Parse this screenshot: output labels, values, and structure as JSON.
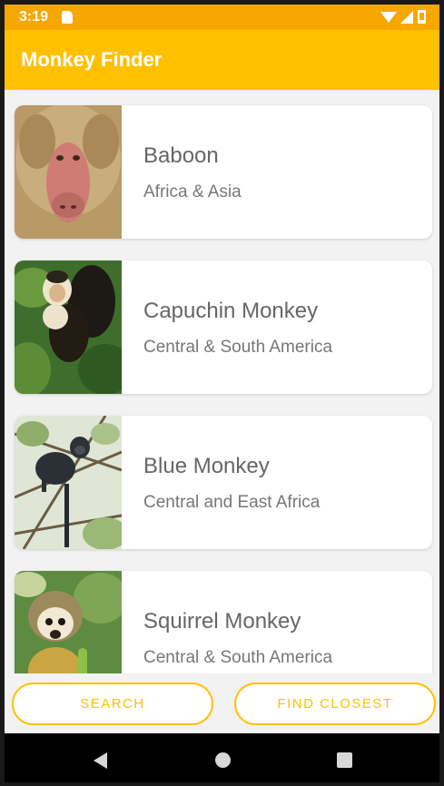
{
  "status_bar": {
    "time": "3:19"
  },
  "app_bar": {
    "title": "Monkey Finder"
  },
  "monkeys": [
    {
      "name": "Baboon",
      "location": "Africa & Asia",
      "image": "baboon-photo"
    },
    {
      "name": "Capuchin Monkey",
      "location": "Central & South America",
      "image": "capuchin-photo"
    },
    {
      "name": "Blue Monkey",
      "location": "Central and East Africa",
      "image": "blue-monkey-photo"
    },
    {
      "name": "Squirrel Monkey",
      "location": "Central & South America",
      "image": "squirrel-monkey-photo"
    }
  ],
  "buttons": {
    "search": "SEARCH",
    "find_closest": "FIND CLOSEST"
  },
  "colors": {
    "app_bar": "#ffc000",
    "status_bar": "#f6a700",
    "accent": "#ffc000"
  }
}
